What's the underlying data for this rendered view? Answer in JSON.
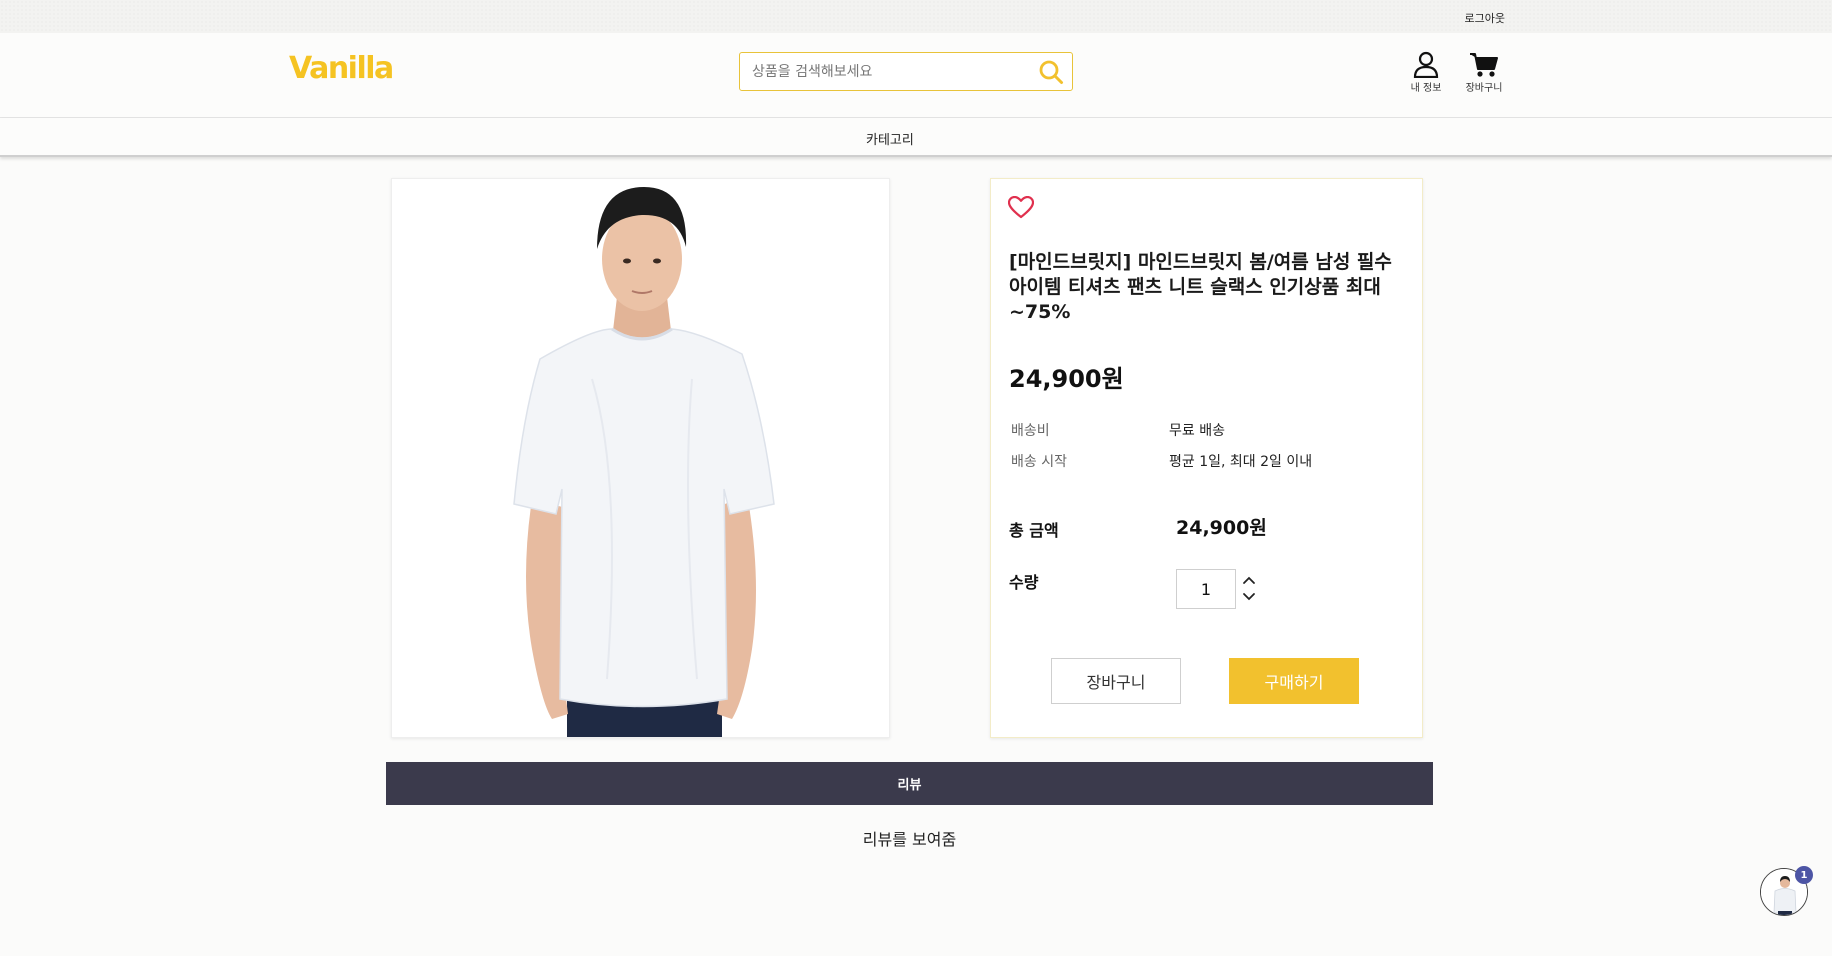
{
  "topbar": {
    "logout_label": "로그아웃"
  },
  "header": {
    "logo": "Vanilla",
    "search_placeholder": "상품을 검색해보세요",
    "my_info_label": "내 정보",
    "cart_label": "장바구니"
  },
  "nav": {
    "category_label": "카테고리"
  },
  "product": {
    "title": "[마인드브릿지] 마인드브릿지 봄/여름 남성 필수아이템 티셔츠 팬츠 니트 슬랙스 인기상품 최대~75%",
    "price": "24,900원",
    "shipping_fee_label": "배송비",
    "shipping_fee_value": "무료 배송",
    "shipping_start_label": "배송 시작",
    "shipping_start_value": "평균 1일, 최대 2일 이내",
    "total_label": "총 금액",
    "total_value": "24,900원",
    "qty_label": "수량",
    "qty_value": "1",
    "cart_button": "장바구니",
    "buy_button": "구매하기"
  },
  "review": {
    "tab_label": "리뷰",
    "content": "리뷰를 보여줌"
  },
  "recent_viewed": {
    "badge_count": "1"
  },
  "colors": {
    "brand": "#f5c322",
    "buy_button": "#f2c12e",
    "review_bar": "#3b3a4c",
    "heart": "#e0304e",
    "badge": "#4d55a5"
  },
  "icons": [
    "search-icon",
    "user-icon",
    "cart-icon",
    "heart-icon",
    "chevron-up-icon",
    "chevron-down-icon"
  ]
}
